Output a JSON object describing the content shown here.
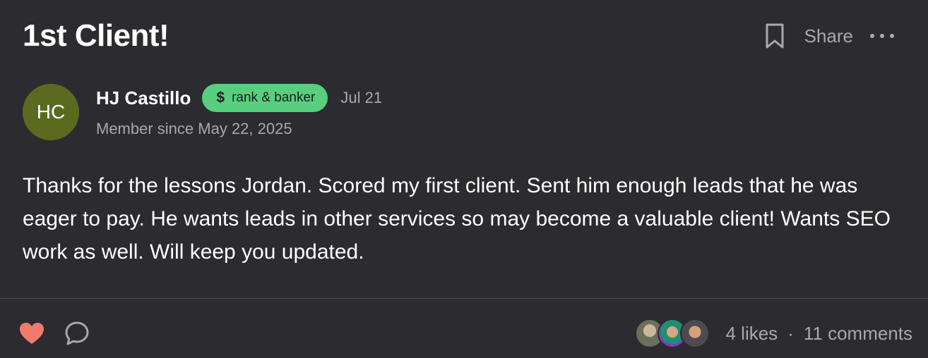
{
  "post": {
    "title": "1st Client!",
    "share_label": "Share",
    "author": {
      "initials": "HC",
      "name": "HJ Castillo",
      "badge_symbol": "$",
      "badge_label": "rank & banker",
      "date": "Jul 21",
      "member_since": "Member since May 22, 2025"
    },
    "body": "Thanks for the lessons Jordan. Scored my first client. Sent him enough leads that he was eager to pay. He wants leads in other services so may become a valuable client! Wants SEO work as well. Will keep you updated.",
    "footer": {
      "likes": "4 likes",
      "separator": "·",
      "comments": "11 comments"
    }
  },
  "icons": {
    "bookmark": "bookmark-icon",
    "more": "more-horizontal-icon",
    "like": "heart-icon",
    "comment": "comment-bubble-icon"
  },
  "colors": {
    "background": "#2b2b30",
    "avatar": "#5c6a1f",
    "badge": "#58cf7e",
    "heart": "#f07b6b",
    "muted_text": "#a8a8ae"
  }
}
